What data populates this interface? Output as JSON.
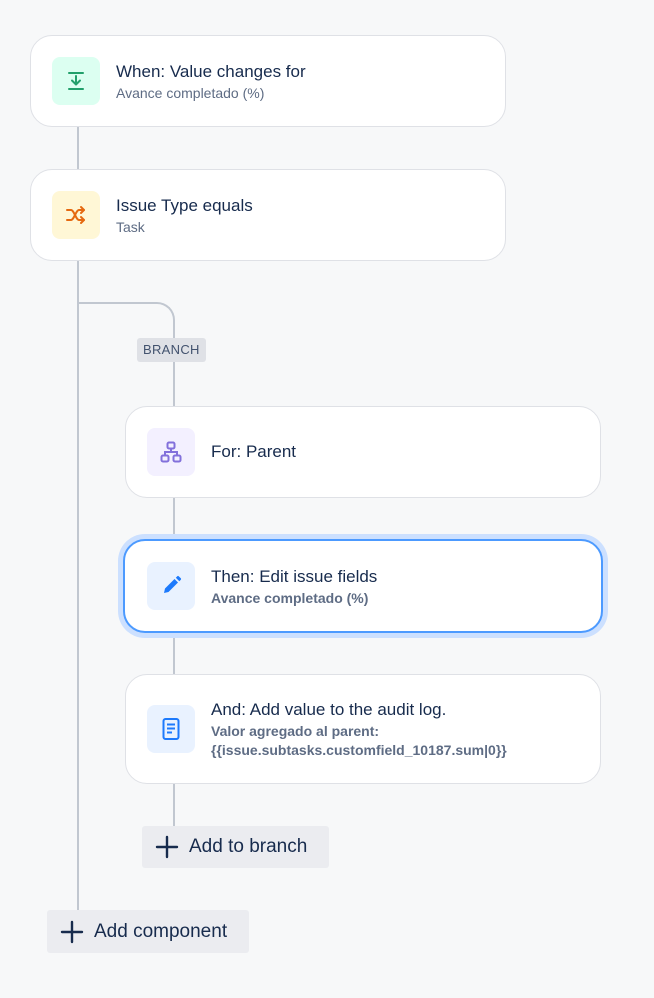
{
  "colors": {
    "trigger_icon": "#22a06b",
    "condition_icon": "#e56910",
    "branch_icon": "#8270db",
    "action_icon": "#1d7afc",
    "selected_border": "#4c9aff",
    "connector": "#c1c7d0"
  },
  "trigger": {
    "icon": "download-icon",
    "title": "When: Value changes for",
    "subtitle": "Avance completado (%)"
  },
  "condition": {
    "icon": "shuffle-icon",
    "title": "Issue Type equals",
    "subtitle": "Task"
  },
  "branch": {
    "label": "BRANCH",
    "for": {
      "icon": "hierarchy-icon",
      "title": "For: Parent"
    },
    "edit_action": {
      "icon": "pencil-icon",
      "title": "Then: Edit issue fields",
      "subtitle": "Avance completado (%)"
    },
    "audit_action": {
      "icon": "document-icon",
      "title": "And: Add value to the audit log.",
      "subtitle_line1": "Valor agregado al parent:",
      "subtitle_line2": "{{issue.subtasks.customfield_10187.sum|0}}"
    },
    "add_to_branch_label": "Add to branch"
  },
  "add_component_label": "Add component"
}
